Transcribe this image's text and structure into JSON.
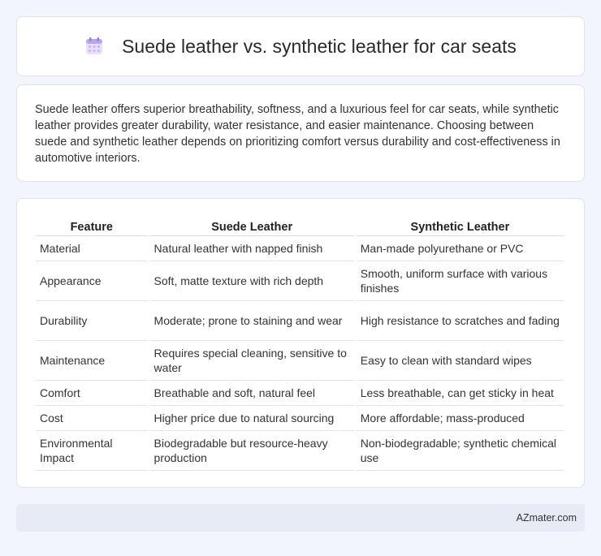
{
  "header": {
    "title": "Suede leather vs. synthetic leather for car seats",
    "icon": "calendar-icon",
    "icon_color": "#c5b5f0"
  },
  "summary": {
    "text": "Suede leather offers superior breathability, softness, and a luxurious feel for car seats, while synthetic leather provides greater durability, water resistance, and easier maintenance. Choosing between suede and synthetic leather depends on prioritizing comfort versus durability and cost-effectiveness in automotive interiors."
  },
  "table": {
    "headers": [
      "Feature",
      "Suede Leather",
      "Synthetic Leather"
    ],
    "rows": [
      [
        "Material",
        "Natural leather with napped finish",
        "Man-made polyurethane or PVC"
      ],
      [
        "Appearance",
        "Soft, matte texture with rich depth",
        "Smooth, uniform surface with various finishes"
      ],
      [
        "Durability",
        "Moderate; prone to staining and wear",
        "High resistance to scratches and fading"
      ],
      [
        "Maintenance",
        "Requires special cleaning, sensitive to water",
        "Easy to clean with standard wipes"
      ],
      [
        "Comfort",
        "Breathable and soft, natural feel",
        "Less breathable, can get sticky in heat"
      ],
      [
        "Cost",
        "Higher price due to natural sourcing",
        "More affordable; mass-produced"
      ],
      [
        "Environmental Impact",
        "Biodegradable but resource-heavy production",
        "Non-biodegradable; synthetic chemical use"
      ]
    ]
  },
  "footer": {
    "brand": "AZmater.com"
  }
}
